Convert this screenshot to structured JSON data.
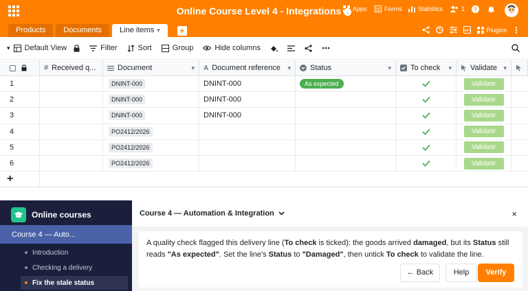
{
  "app": {
    "title": "Online Course Level 4 - Integrations",
    "top_actions": {
      "apps": "Apps",
      "forms": "Forms",
      "statistics": "Statistics",
      "users_count": "1"
    },
    "tabs": [
      {
        "label": "Products"
      },
      {
        "label": "Documents"
      },
      {
        "label": "Line items"
      }
    ],
    "plugins_label": "Plugins"
  },
  "toolbar": {
    "view": "Default View",
    "filter": "Filter",
    "sort": "Sort",
    "group": "Group",
    "hide_columns": "Hide columns"
  },
  "table": {
    "columns": [
      "Received q...",
      "Document",
      "Document reference",
      "Status",
      "To check",
      "Validate"
    ],
    "rows": [
      {
        "n": "1",
        "document": "DNINT-000",
        "reference": "DNINT-000",
        "status": "As expected",
        "to_check": true,
        "validate": "Validate"
      },
      {
        "n": "2",
        "document": "DNINT-000",
        "reference": "DNINT-000",
        "status": "",
        "to_check": true,
        "validate": "Validate"
      },
      {
        "n": "3",
        "document": "DNINT-000",
        "reference": "DNINT-000",
        "status": "",
        "to_check": true,
        "validate": "Validate"
      },
      {
        "n": "4",
        "document": "PO2412/2026",
        "reference": "",
        "status": "",
        "to_check": true,
        "validate": "Validate"
      },
      {
        "n": "5",
        "document": "PO2412/2026",
        "reference": "",
        "status": "",
        "to_check": true,
        "validate": "Validate"
      },
      {
        "n": "6",
        "document": "PO2412/2026",
        "reference": "",
        "status": "",
        "to_check": true,
        "validate": "Validate"
      }
    ],
    "add_row": "+"
  },
  "sidebar": {
    "title": "Online courses",
    "course": "Course 4 — Auto...",
    "items": [
      {
        "label": "Introduction"
      },
      {
        "label": "Checking a delivery"
      },
      {
        "label": "Fix the stale status"
      }
    ]
  },
  "panel": {
    "course_title": "Course 4 — Automation & Integration",
    "close": "×",
    "message": {
      "p1": "A quality check flagged this delivery line (",
      "b1": "To check",
      "p2": " is ticked): the goods arrived ",
      "b2": "damaged",
      "p3": ", but its ",
      "b3": "Status",
      "p4": " still reads ",
      "b4": "\"As expected\"",
      "p5": ". Set the line's ",
      "b5": "Status",
      "p6": " to ",
      "b6": "\"Damaged\"",
      "p7": ", then untick ",
      "b7": "To check",
      "p8": " to validate the line."
    },
    "back": "← Back",
    "help": "Help",
    "verify": "Verify"
  },
  "colors": {
    "accent": "#ff8000",
    "status_green": "#4caf50",
    "validate_green": "#a8d88a",
    "sidebar_bg": "#1b1f3b"
  }
}
